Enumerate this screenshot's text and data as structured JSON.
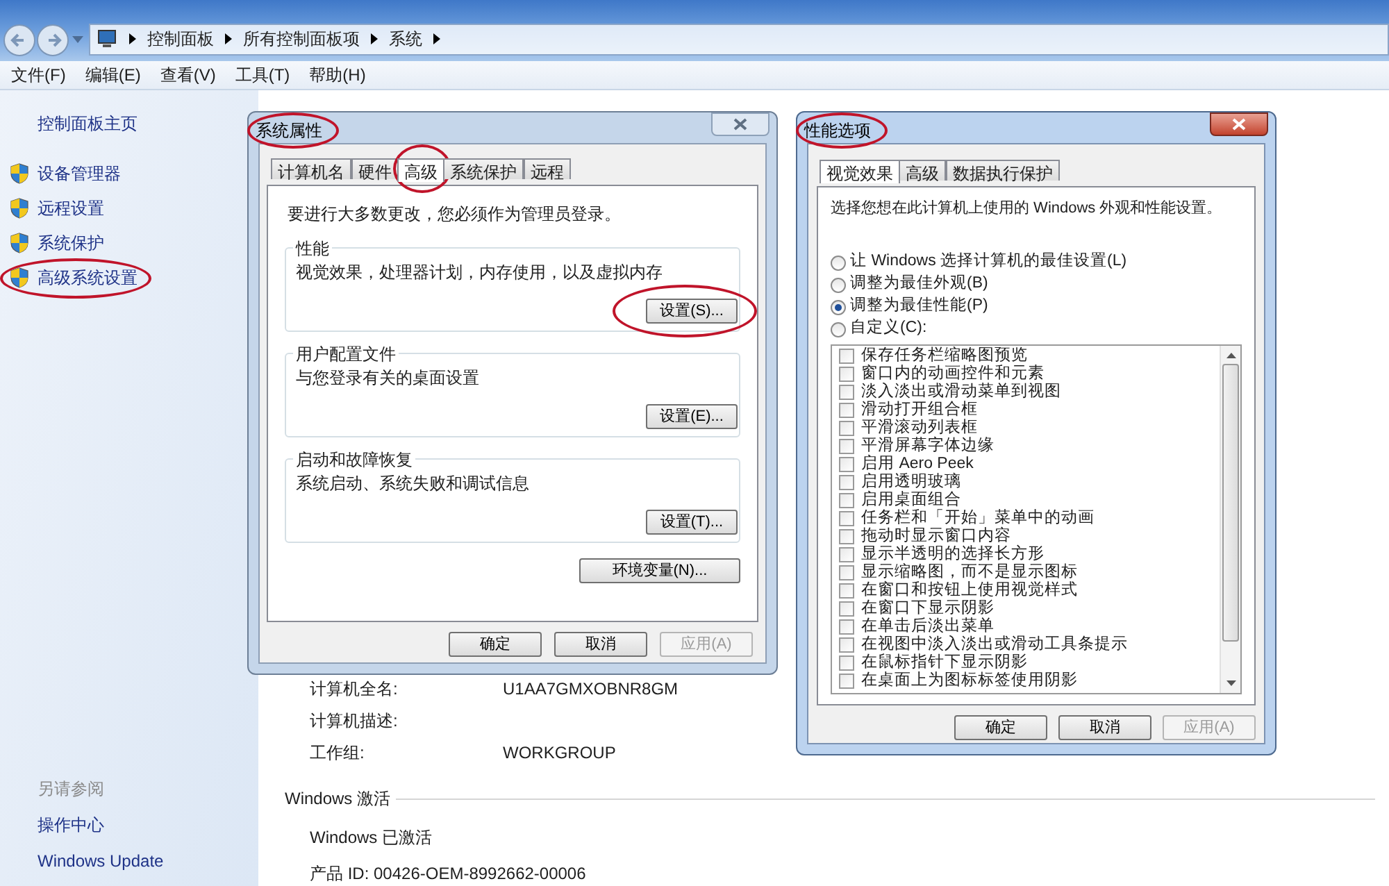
{
  "explorer": {
    "breadcrumb": [
      "控制面板",
      "所有控制面板项",
      "系统"
    ],
    "menu": [
      "文件(F)",
      "编辑(E)",
      "查看(V)",
      "工具(T)",
      "帮助(H)"
    ],
    "sidebar": {
      "home": "控制面板主页",
      "items": [
        {
          "label": "设备管理器",
          "circled": false
        },
        {
          "label": "远程设置",
          "circled": false
        },
        {
          "label": "系统保护",
          "circled": false
        },
        {
          "label": "高级系统设置",
          "circled": true
        }
      ],
      "see_also_title": "另请参阅",
      "see_also": [
        "操作中心",
        "Windows Update"
      ]
    },
    "computer_info": [
      {
        "label": "计算机全名:",
        "value": "U1AA7GMXOBNR8GM"
      },
      {
        "label": "计算机描述:"
      },
      {
        "label": "工作组:",
        "value": "WORKGROUP"
      }
    ],
    "activation": {
      "heading": "Windows 激活",
      "status": "Windows 已激活",
      "product_id": "产品 ID: 00426-OEM-8992662-00006"
    }
  },
  "system_properties": {
    "title": "系统属性",
    "title_circled": true,
    "active": false,
    "tabs": [
      {
        "label": "计算机名",
        "selected": false,
        "circled": false
      },
      {
        "label": "硬件",
        "selected": false,
        "circled": false
      },
      {
        "label": "高级",
        "selected": true,
        "circled": true
      },
      {
        "label": "系统保护",
        "selected": false,
        "circled": false
      },
      {
        "label": "远程",
        "selected": false,
        "circled": false
      }
    ],
    "notice": "要进行大多数更改，您必须作为管理员登录。",
    "groups": [
      {
        "title": "性能",
        "description": "视觉效果，处理器计划，内存使用，以及虚拟内存",
        "button": "设置(S)...",
        "button_circled": true
      },
      {
        "title": "用户配置文件",
        "description": "与您登录有关的桌面设置",
        "button": "设置(E)...",
        "button_circled": false
      },
      {
        "title": "启动和故障恢复",
        "description": "系统启动、系统失败和调试信息",
        "button": "设置(T)...",
        "button_circled": false
      }
    ],
    "env_button": "环境变量(N)...",
    "buttons": [
      {
        "label": "确定",
        "disabled": false
      },
      {
        "label": "取消",
        "disabled": false
      },
      {
        "label": "应用(A)",
        "disabled": true
      }
    ]
  },
  "performance_options": {
    "title": "性能选项",
    "title_circled": true,
    "active": true,
    "tabs": [
      {
        "label": "视觉效果",
        "selected": true
      },
      {
        "label": "高级",
        "selected": false
      },
      {
        "label": "数据执行保护",
        "selected": false
      }
    ],
    "intro": "选择您想在此计算机上使用的 Windows 外观和性能设置。",
    "radios": [
      {
        "label": "让 Windows 选择计算机的最佳设置(L)",
        "selected": false
      },
      {
        "label": "调整为最佳外观(B)",
        "selected": false
      },
      {
        "label": "调整为最佳性能(P)",
        "selected": true
      },
      {
        "label": "自定义(C):",
        "selected": false
      }
    ],
    "checkboxes": [
      {
        "label": "保存任务栏缩略图预览",
        "checked": false
      },
      {
        "label": "窗口内的动画控件和元素",
        "checked": false
      },
      {
        "label": "淡入淡出或滑动菜单到视图",
        "checked": false
      },
      {
        "label": "滑动打开组合框",
        "checked": false
      },
      {
        "label": "平滑滚动列表框",
        "checked": false
      },
      {
        "label": "平滑屏幕字体边缘",
        "checked": false
      },
      {
        "label": "启用 Aero Peek",
        "checked": false
      },
      {
        "label": "启用透明玻璃",
        "checked": false
      },
      {
        "label": "启用桌面组合",
        "checked": false
      },
      {
        "label": "任务栏和「开始」菜单中的动画",
        "checked": false
      },
      {
        "label": "拖动时显示窗口内容",
        "checked": false
      },
      {
        "label": "显示半透明的选择长方形",
        "checked": false
      },
      {
        "label": "显示缩略图，而不是显示图标",
        "checked": false
      },
      {
        "label": "在窗口和按钮上使用视觉样式",
        "checked": false
      },
      {
        "label": "在窗口下显示阴影",
        "checked": false
      },
      {
        "label": "在单击后淡出菜单",
        "checked": false
      },
      {
        "label": "在视图中淡入淡出或滑动工具条提示",
        "checked": false
      },
      {
        "label": "在鼠标指针下显示阴影",
        "checked": false
      },
      {
        "label": "在桌面上为图标标签使用阴影",
        "checked": false
      }
    ],
    "buttons": [
      {
        "label": "确定",
        "disabled": false
      },
      {
        "label": "取消",
        "disabled": false
      },
      {
        "label": "应用(A)",
        "disabled": true
      }
    ]
  }
}
